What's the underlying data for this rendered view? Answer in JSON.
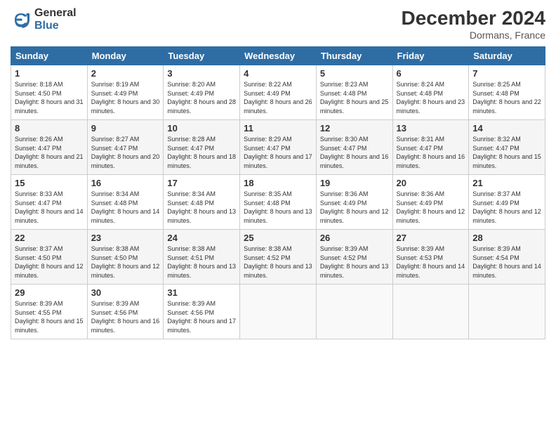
{
  "header": {
    "logo_general": "General",
    "logo_blue": "Blue",
    "month_year": "December 2024",
    "location": "Dormans, France"
  },
  "days_of_week": [
    "Sunday",
    "Monday",
    "Tuesday",
    "Wednesday",
    "Thursday",
    "Friday",
    "Saturday"
  ],
  "weeks": [
    [
      {
        "day": "1",
        "sunrise": "Sunrise: 8:18 AM",
        "sunset": "Sunset: 4:50 PM",
        "daylight": "Daylight: 8 hours and 31 minutes."
      },
      {
        "day": "2",
        "sunrise": "Sunrise: 8:19 AM",
        "sunset": "Sunset: 4:49 PM",
        "daylight": "Daylight: 8 hours and 30 minutes."
      },
      {
        "day": "3",
        "sunrise": "Sunrise: 8:20 AM",
        "sunset": "Sunset: 4:49 PM",
        "daylight": "Daylight: 8 hours and 28 minutes."
      },
      {
        "day": "4",
        "sunrise": "Sunrise: 8:22 AM",
        "sunset": "Sunset: 4:49 PM",
        "daylight": "Daylight: 8 hours and 26 minutes."
      },
      {
        "day": "5",
        "sunrise": "Sunrise: 8:23 AM",
        "sunset": "Sunset: 4:48 PM",
        "daylight": "Daylight: 8 hours and 25 minutes."
      },
      {
        "day": "6",
        "sunrise": "Sunrise: 8:24 AM",
        "sunset": "Sunset: 4:48 PM",
        "daylight": "Daylight: 8 hours and 23 minutes."
      },
      {
        "day": "7",
        "sunrise": "Sunrise: 8:25 AM",
        "sunset": "Sunset: 4:48 PM",
        "daylight": "Daylight: 8 hours and 22 minutes."
      }
    ],
    [
      {
        "day": "8",
        "sunrise": "Sunrise: 8:26 AM",
        "sunset": "Sunset: 4:47 PM",
        "daylight": "Daylight: 8 hours and 21 minutes."
      },
      {
        "day": "9",
        "sunrise": "Sunrise: 8:27 AM",
        "sunset": "Sunset: 4:47 PM",
        "daylight": "Daylight: 8 hours and 20 minutes."
      },
      {
        "day": "10",
        "sunrise": "Sunrise: 8:28 AM",
        "sunset": "Sunset: 4:47 PM",
        "daylight": "Daylight: 8 hours and 18 minutes."
      },
      {
        "day": "11",
        "sunrise": "Sunrise: 8:29 AM",
        "sunset": "Sunset: 4:47 PM",
        "daylight": "Daylight: 8 hours and 17 minutes."
      },
      {
        "day": "12",
        "sunrise": "Sunrise: 8:30 AM",
        "sunset": "Sunset: 4:47 PM",
        "daylight": "Daylight: 8 hours and 16 minutes."
      },
      {
        "day": "13",
        "sunrise": "Sunrise: 8:31 AM",
        "sunset": "Sunset: 4:47 PM",
        "daylight": "Daylight: 8 hours and 16 minutes."
      },
      {
        "day": "14",
        "sunrise": "Sunrise: 8:32 AM",
        "sunset": "Sunset: 4:47 PM",
        "daylight": "Daylight: 8 hours and 15 minutes."
      }
    ],
    [
      {
        "day": "15",
        "sunrise": "Sunrise: 8:33 AM",
        "sunset": "Sunset: 4:47 PM",
        "daylight": "Daylight: 8 hours and 14 minutes."
      },
      {
        "day": "16",
        "sunrise": "Sunrise: 8:34 AM",
        "sunset": "Sunset: 4:48 PM",
        "daylight": "Daylight: 8 hours and 14 minutes."
      },
      {
        "day": "17",
        "sunrise": "Sunrise: 8:34 AM",
        "sunset": "Sunset: 4:48 PM",
        "daylight": "Daylight: 8 hours and 13 minutes."
      },
      {
        "day": "18",
        "sunrise": "Sunrise: 8:35 AM",
        "sunset": "Sunset: 4:48 PM",
        "daylight": "Daylight: 8 hours and 13 minutes."
      },
      {
        "day": "19",
        "sunrise": "Sunrise: 8:36 AM",
        "sunset": "Sunset: 4:49 PM",
        "daylight": "Daylight: 8 hours and 12 minutes."
      },
      {
        "day": "20",
        "sunrise": "Sunrise: 8:36 AM",
        "sunset": "Sunset: 4:49 PM",
        "daylight": "Daylight: 8 hours and 12 minutes."
      },
      {
        "day": "21",
        "sunrise": "Sunrise: 8:37 AM",
        "sunset": "Sunset: 4:49 PM",
        "daylight": "Daylight: 8 hours and 12 minutes."
      }
    ],
    [
      {
        "day": "22",
        "sunrise": "Sunrise: 8:37 AM",
        "sunset": "Sunset: 4:50 PM",
        "daylight": "Daylight: 8 hours and 12 minutes."
      },
      {
        "day": "23",
        "sunrise": "Sunrise: 8:38 AM",
        "sunset": "Sunset: 4:50 PM",
        "daylight": "Daylight: 8 hours and 12 minutes."
      },
      {
        "day": "24",
        "sunrise": "Sunrise: 8:38 AM",
        "sunset": "Sunset: 4:51 PM",
        "daylight": "Daylight: 8 hours and 13 minutes."
      },
      {
        "day": "25",
        "sunrise": "Sunrise: 8:38 AM",
        "sunset": "Sunset: 4:52 PM",
        "daylight": "Daylight: 8 hours and 13 minutes."
      },
      {
        "day": "26",
        "sunrise": "Sunrise: 8:39 AM",
        "sunset": "Sunset: 4:52 PM",
        "daylight": "Daylight: 8 hours and 13 minutes."
      },
      {
        "day": "27",
        "sunrise": "Sunrise: 8:39 AM",
        "sunset": "Sunset: 4:53 PM",
        "daylight": "Daylight: 8 hours and 14 minutes."
      },
      {
        "day": "28",
        "sunrise": "Sunrise: 8:39 AM",
        "sunset": "Sunset: 4:54 PM",
        "daylight": "Daylight: 8 hours and 14 minutes."
      }
    ],
    [
      {
        "day": "29",
        "sunrise": "Sunrise: 8:39 AM",
        "sunset": "Sunset: 4:55 PM",
        "daylight": "Daylight: 8 hours and 15 minutes."
      },
      {
        "day": "30",
        "sunrise": "Sunrise: 8:39 AM",
        "sunset": "Sunset: 4:56 PM",
        "daylight": "Daylight: 8 hours and 16 minutes."
      },
      {
        "day": "31",
        "sunrise": "Sunrise: 8:39 AM",
        "sunset": "Sunset: 4:56 PM",
        "daylight": "Daylight: 8 hours and 17 minutes."
      },
      null,
      null,
      null,
      null
    ]
  ]
}
